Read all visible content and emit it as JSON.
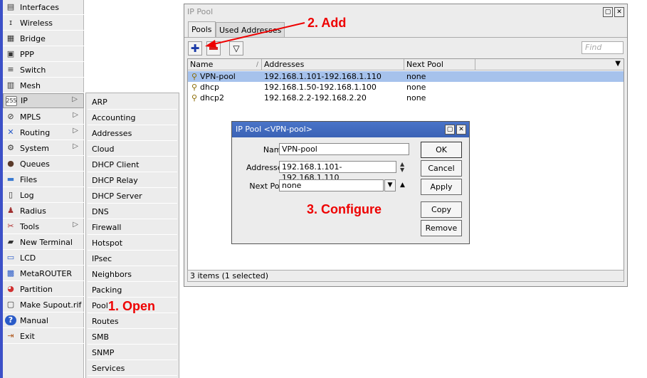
{
  "sidebar": {
    "items": [
      {
        "label": "Interfaces",
        "icon": "interfaces-icon",
        "glyph": "▤"
      },
      {
        "label": "Wireless",
        "icon": "wireless-icon",
        "glyph": "ɪ"
      },
      {
        "label": "Bridge",
        "icon": "bridge-icon",
        "glyph": "▦"
      },
      {
        "label": "PPP",
        "icon": "ppp-icon",
        "glyph": "▣"
      },
      {
        "label": "Switch",
        "icon": "switch-icon",
        "glyph": "≡"
      },
      {
        "label": "Mesh",
        "icon": "mesh-icon",
        "glyph": "▥"
      },
      {
        "label": "IP",
        "icon": "ip-icon",
        "glyph": "255",
        "arrow": "▷"
      },
      {
        "label": "MPLS",
        "icon": "mpls-icon",
        "glyph": "⊘",
        "arrow": "▷"
      },
      {
        "label": "Routing",
        "icon": "routing-icon",
        "glyph": "✕",
        "arrow": "▷"
      },
      {
        "label": "System",
        "icon": "system-icon",
        "glyph": "⚙",
        "arrow": "▷"
      },
      {
        "label": "Queues",
        "icon": "queues-icon",
        "glyph": "●"
      },
      {
        "label": "Files",
        "icon": "files-icon",
        "glyph": "▬"
      },
      {
        "label": "Log",
        "icon": "log-icon",
        "glyph": "▯"
      },
      {
        "label": "Radius",
        "icon": "radius-icon",
        "glyph": "♟"
      },
      {
        "label": "Tools",
        "icon": "tools-icon",
        "glyph": "✂",
        "arrow": "▷"
      },
      {
        "label": "New Terminal",
        "icon": "terminal-icon",
        "glyph": "▰"
      },
      {
        "label": "LCD",
        "icon": "lcd-icon",
        "glyph": "▭"
      },
      {
        "label": "MetaROUTER",
        "icon": "metarouter-icon",
        "glyph": "▩"
      },
      {
        "label": "Partition",
        "icon": "partition-icon",
        "glyph": "◕"
      },
      {
        "label": "Make Supout.rif",
        "icon": "supout-icon",
        "glyph": "▢"
      },
      {
        "label": "Manual",
        "icon": "manual-icon",
        "glyph": "?"
      },
      {
        "label": "Exit",
        "icon": "exit-icon",
        "glyph": "⇥"
      }
    ]
  },
  "ip_submenu": {
    "items": [
      "ARP",
      "Accounting",
      "Addresses",
      "Cloud",
      "DHCP Client",
      "DHCP Relay",
      "DHCP Server",
      "DNS",
      "Firewall",
      "Hotspot",
      "IPsec",
      "Neighbors",
      "Packing",
      "Pool",
      "Routes",
      "SMB",
      "SNMP",
      "Services"
    ]
  },
  "annotations": {
    "open": "1. Open",
    "add": "2. Add",
    "configure": "3. Configure"
  },
  "pool_window": {
    "title": "IP Pool",
    "tabs": [
      "Pools",
      "Used Addresses"
    ],
    "find_placeholder": "Find",
    "columns": [
      "Name",
      "Addresses",
      "Next Pool"
    ],
    "rows": [
      {
        "name": "VPN-pool",
        "addresses": "192.168.1.101-192.168.1.110",
        "next_pool": "none",
        "selected": true
      },
      {
        "name": "dhcp",
        "addresses": "192.168.1.50-192.168.1.100",
        "next_pool": "none",
        "selected": false
      },
      {
        "name": "dhcp2",
        "addresses": "192.168.2.2-192.168.2.20",
        "next_pool": "none",
        "selected": false
      }
    ],
    "status": "3 items (1 selected)"
  },
  "dialog": {
    "title": "IP Pool <VPN-pool>",
    "name_label": "Name:",
    "name_value": "VPN-pool",
    "addresses_label": "Addresses:",
    "addresses_value": "192.168.1.101-192.168.1.110",
    "next_pool_label": "Next Pool:",
    "next_pool_value": "none",
    "buttons": {
      "ok": "OK",
      "cancel": "Cancel",
      "apply": "Apply",
      "copy": "Copy",
      "remove": "Remove"
    }
  },
  "colors": {
    "selection": "#a6c2ec",
    "dialog_title": "#3a62b5",
    "annotation": "#e00000",
    "left_stripe": "#3c50c8"
  }
}
